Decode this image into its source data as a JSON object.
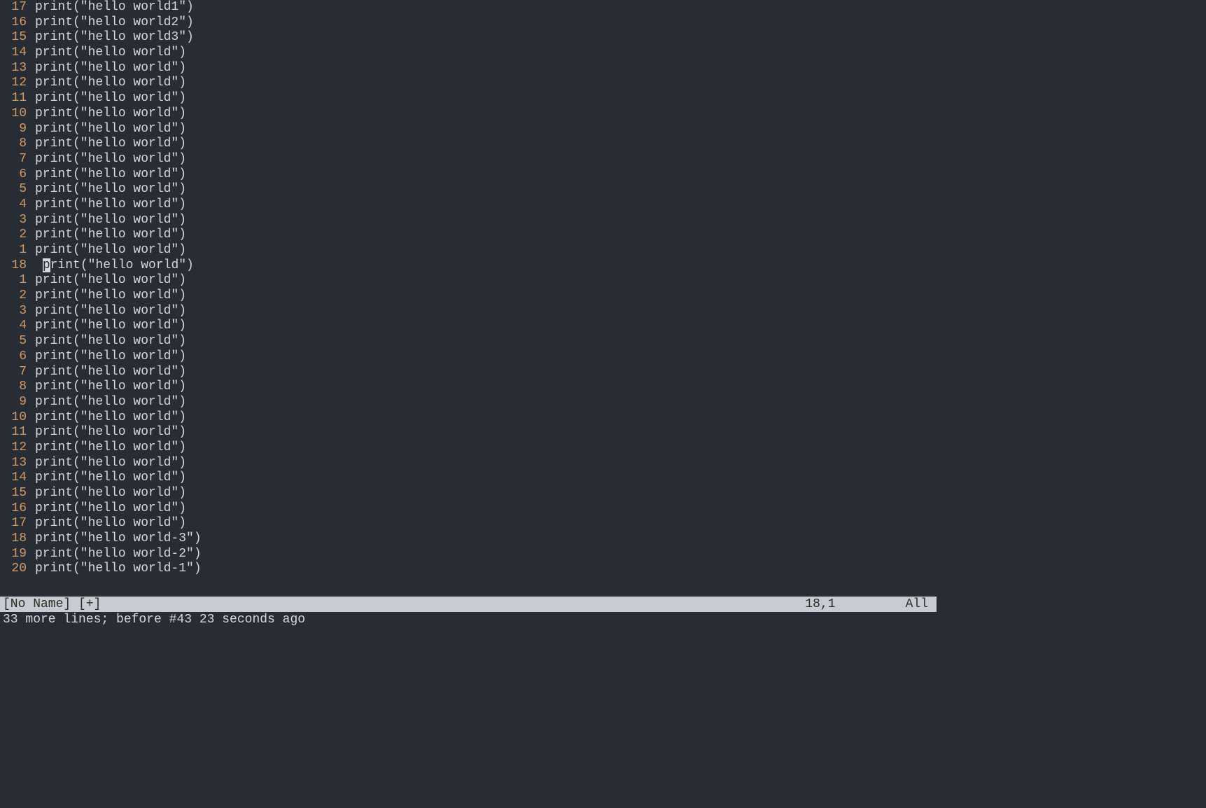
{
  "editor": {
    "lines": [
      {
        "num": "17",
        "text": "print(\"hello world1\")",
        "current": false,
        "cursor": false
      },
      {
        "num": "16",
        "text": "print(\"hello world2\")",
        "current": false,
        "cursor": false
      },
      {
        "num": "15",
        "text": "print(\"hello world3\")",
        "current": false,
        "cursor": false
      },
      {
        "num": "14",
        "text": "print(\"hello world\")",
        "current": false,
        "cursor": false
      },
      {
        "num": "13",
        "text": "print(\"hello world\")",
        "current": false,
        "cursor": false
      },
      {
        "num": "12",
        "text": "print(\"hello world\")",
        "current": false,
        "cursor": false
      },
      {
        "num": "11",
        "text": "print(\"hello world\")",
        "current": false,
        "cursor": false
      },
      {
        "num": "10",
        "text": "print(\"hello world\")",
        "current": false,
        "cursor": false
      },
      {
        "num": "9",
        "text": "print(\"hello world\")",
        "current": false,
        "cursor": false
      },
      {
        "num": "8",
        "text": "print(\"hello world\")",
        "current": false,
        "cursor": false
      },
      {
        "num": "7",
        "text": "print(\"hello world\")",
        "current": false,
        "cursor": false
      },
      {
        "num": "6",
        "text": "print(\"hello world\")",
        "current": false,
        "cursor": false
      },
      {
        "num": "5",
        "text": "print(\"hello world\")",
        "current": false,
        "cursor": false
      },
      {
        "num": "4",
        "text": "print(\"hello world\")",
        "current": false,
        "cursor": false
      },
      {
        "num": "3",
        "text": "print(\"hello world\")",
        "current": false,
        "cursor": false
      },
      {
        "num": "2",
        "text": "print(\"hello world\")",
        "current": false,
        "cursor": false
      },
      {
        "num": "1",
        "text": "print(\"hello world\")",
        "current": false,
        "cursor": false
      },
      {
        "num": "18",
        "text": " print(\"hello world\")",
        "current": true,
        "cursor": true
      },
      {
        "num": "1",
        "text": "print(\"hello world\")",
        "current": false,
        "cursor": false
      },
      {
        "num": "2",
        "text": "print(\"hello world\")",
        "current": false,
        "cursor": false
      },
      {
        "num": "3",
        "text": "print(\"hello world\")",
        "current": false,
        "cursor": false
      },
      {
        "num": "4",
        "text": "print(\"hello world\")",
        "current": false,
        "cursor": false
      },
      {
        "num": "5",
        "text": "print(\"hello world\")",
        "current": false,
        "cursor": false
      },
      {
        "num": "6",
        "text": "print(\"hello world\")",
        "current": false,
        "cursor": false
      },
      {
        "num": "7",
        "text": "print(\"hello world\")",
        "current": false,
        "cursor": false
      },
      {
        "num": "8",
        "text": "print(\"hello world\")",
        "current": false,
        "cursor": false
      },
      {
        "num": "9",
        "text": "print(\"hello world\")",
        "current": false,
        "cursor": false
      },
      {
        "num": "10",
        "text": "print(\"hello world\")",
        "current": false,
        "cursor": false
      },
      {
        "num": "11",
        "text": "print(\"hello world\")",
        "current": false,
        "cursor": false
      },
      {
        "num": "12",
        "text": "print(\"hello world\")",
        "current": false,
        "cursor": false
      },
      {
        "num": "13",
        "text": "print(\"hello world\")",
        "current": false,
        "cursor": false
      },
      {
        "num": "14",
        "text": "print(\"hello world\")",
        "current": false,
        "cursor": false
      },
      {
        "num": "15",
        "text": "print(\"hello world\")",
        "current": false,
        "cursor": false
      },
      {
        "num": "16",
        "text": "print(\"hello world\")",
        "current": false,
        "cursor": false
      },
      {
        "num": "17",
        "text": "print(\"hello world\")",
        "current": false,
        "cursor": false
      },
      {
        "num": "18",
        "text": "print(\"hello world-3\")",
        "current": false,
        "cursor": false
      },
      {
        "num": "19",
        "text": "print(\"hello world-2\")",
        "current": false,
        "cursor": false
      },
      {
        "num": "20",
        "text": "print(\"hello world-1\")",
        "current": false,
        "cursor": false
      }
    ]
  },
  "status": {
    "filename": "[No Name]",
    "modified": "[+]",
    "position": "18,1",
    "scroll": "All"
  },
  "message": "33 more lines; before #43  23 seconds ago"
}
